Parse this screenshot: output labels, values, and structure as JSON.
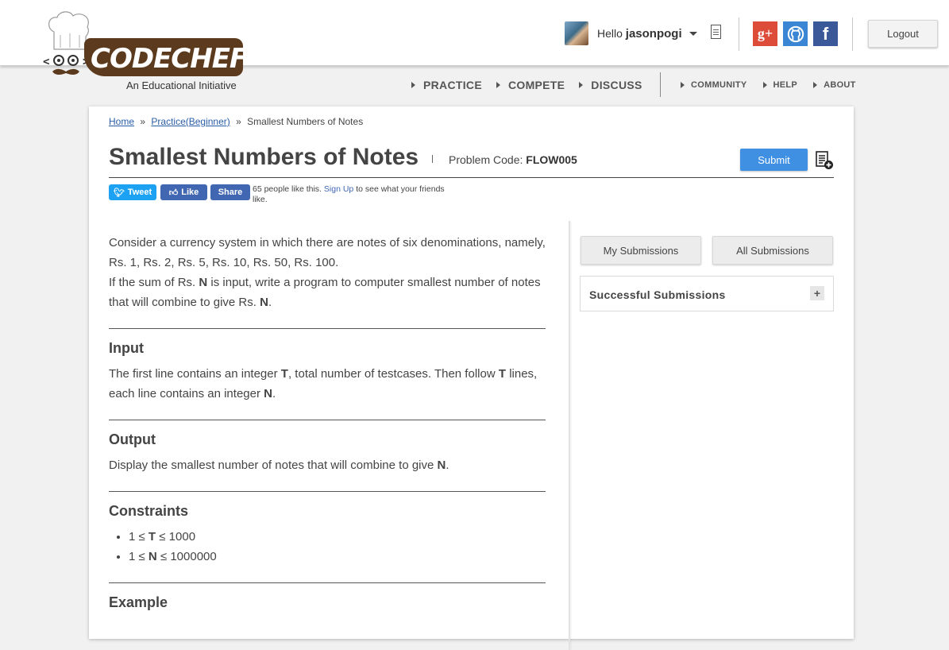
{
  "logo": {
    "wordmark": "CODECHEF",
    "tagline": "An Educational Initiative"
  },
  "user": {
    "greeting": "Hello",
    "username": "jasonpogi"
  },
  "header": {
    "logout_label": "Logout",
    "social": {
      "gplus": "g+",
      "facebook": "f"
    }
  },
  "nav": {
    "main": [
      "PRACTICE",
      "COMPETE",
      "DISCUSS"
    ],
    "sub": [
      "COMMUNITY",
      "HELP",
      "ABOUT"
    ]
  },
  "breadcrumb": {
    "home": "Home",
    "practice": "Practice(Beginner)",
    "current": "Smallest Numbers of Notes",
    "separator": "»"
  },
  "problem": {
    "title": "Smallest Numbers of Notes",
    "code_label": "Problem Code:",
    "code": "FLOW005",
    "submit_label": "Submit"
  },
  "share": {
    "tweet": "Tweet",
    "like": "Like",
    "share": "Share",
    "like_text_prefix": "65 people like this.",
    "signup": "Sign Up",
    "like_text_suffix": "to see what your friends like."
  },
  "statement": {
    "p1_a": "Consider a currency system in which there are notes of six denominations, namely, Rs. 1, Rs. 2, Rs. 5, Rs. 10, Rs. 50, Rs. 100.",
    "p1_b_pre": "If the sum of Rs.",
    "p1_b_n": "N",
    "p1_b_mid": "is input, write a program to computer smallest number of notes that will combine to give Rs.",
    "p1_b_n2": "N",
    "p1_b_end": "."
  },
  "sections": {
    "input": {
      "heading": "Input",
      "t1": "The first line contains an integer",
      "b1": "T",
      "t2": ", total number of testcases. Then follow",
      "b2": "T",
      "t3": "lines, each line contains an integer",
      "b3": "N",
      "t4": "."
    },
    "output": {
      "heading": "Output",
      "t1": "Display the smallest number of notes that will combine to give",
      "b1": "N",
      "t2": "."
    },
    "constraints": {
      "heading": "Constraints",
      "items": [
        {
          "pre": "1 ≤",
          "var": "T",
          "post": "≤ 1000"
        },
        {
          "pre": "1 ≤",
          "var": "N",
          "post": "≤ 1000000"
        }
      ]
    },
    "example": {
      "heading": "Example"
    }
  },
  "sidebar": {
    "my_submissions": "My Submissions",
    "all_submissions": "All Submissions",
    "successful_submissions": "Successful Submissions",
    "expand": "+"
  },
  "colors": {
    "submit_blue": "#3f8fe2",
    "logo_brown": "#5b3a1d",
    "link_blue": "#2a5da8"
  }
}
